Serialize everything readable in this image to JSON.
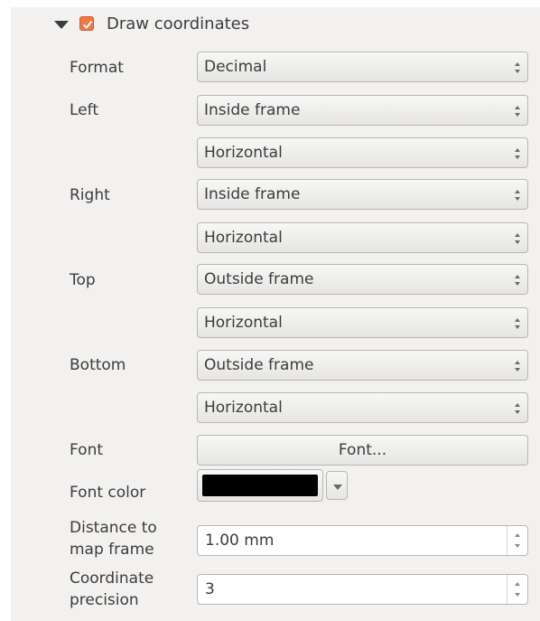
{
  "section": {
    "title": "Draw coordinates",
    "checked": true,
    "expanded": true
  },
  "labels": {
    "format": "Format",
    "left": "Left",
    "right": "Right",
    "top": "Top",
    "bottom": "Bottom",
    "font": "Font",
    "font_color": "Font color",
    "distance_line1": "Distance to",
    "distance_line2": "map frame",
    "precision_line1": "Coordinate",
    "precision_line2": "precision"
  },
  "values": {
    "format": "Decimal",
    "left_position": "Inside frame",
    "left_direction": "Horizontal",
    "right_position": "Inside frame",
    "right_direction": "Horizontal",
    "top_position": "Outside frame",
    "top_direction": "Horizontal",
    "bottom_position": "Outside frame",
    "bottom_direction": "Horizontal",
    "font_button": "Font...",
    "font_color": "#000000",
    "distance": "1.00 mm",
    "precision": "3"
  },
  "icons": {
    "expand": "triangle-down-icon",
    "checkbox": "checkmark-icon",
    "combo": "updown-arrows-icon",
    "color_dropdown": "chevron-down-icon"
  }
}
